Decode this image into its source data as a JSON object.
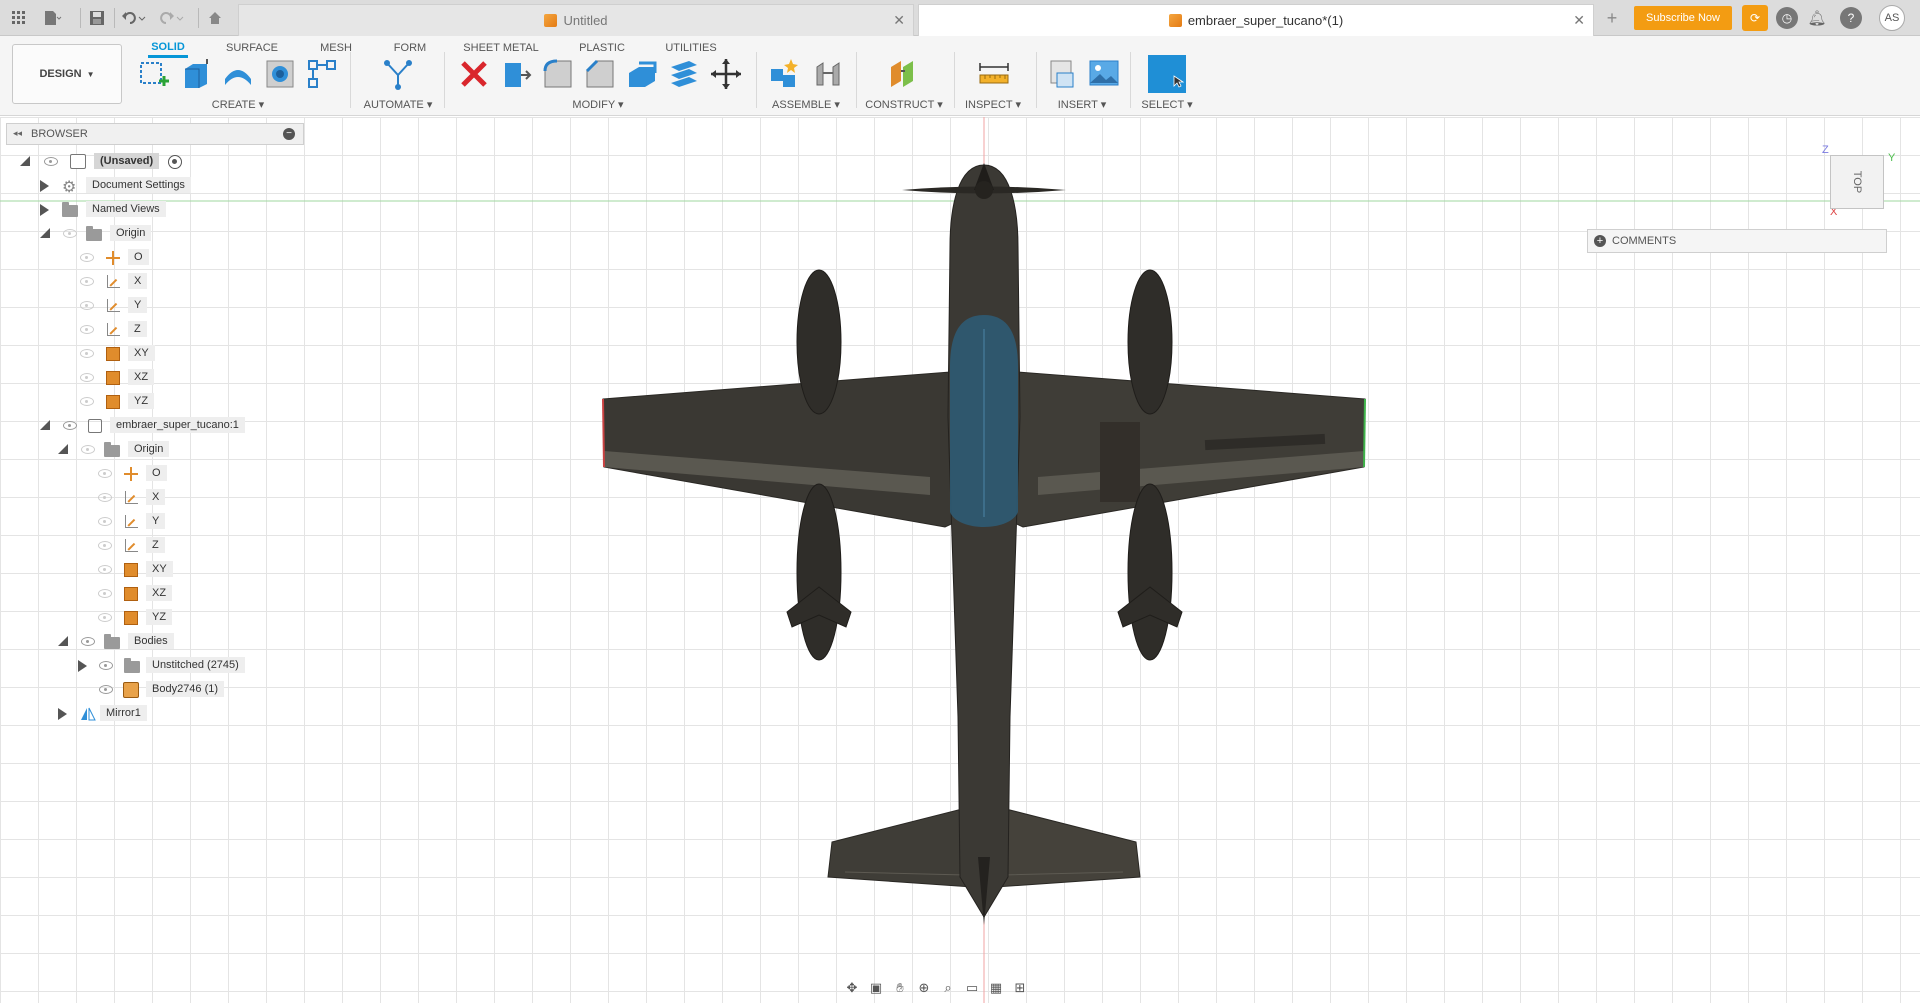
{
  "tabs": [
    {
      "label": "Untitled",
      "active": false
    },
    {
      "label": "embraer_super_tucano*(1)",
      "active": true
    }
  ],
  "header": {
    "subscribe_label": "Subscribe Now",
    "avatar_initials": "AS"
  },
  "toolbar": {
    "workspace_label": "DESIGN",
    "workspace_tabs": [
      "SOLID",
      "SURFACE",
      "MESH",
      "FORM",
      "SHEET METAL",
      "PLASTIC",
      "UTILITIES"
    ],
    "active_tab": "SOLID",
    "groups": [
      "CREATE",
      "AUTOMATE",
      "MODIFY",
      "ASSEMBLE",
      "CONSTRUCT",
      "INSPECT",
      "INSERT",
      "SELECT"
    ]
  },
  "browser": {
    "title": "BROWSER",
    "root_label": "(Unsaved)",
    "rows": [
      {
        "label": "Document Settings"
      },
      {
        "label": "Named Views"
      },
      {
        "label": "Origin"
      },
      {
        "label": "O"
      },
      {
        "label": "X"
      },
      {
        "label": "Y"
      },
      {
        "label": "Z"
      },
      {
        "label": "XY"
      },
      {
        "label": "XZ"
      },
      {
        "label": "YZ"
      },
      {
        "label": "embraer_super_tucano:1"
      },
      {
        "label": "Origin"
      },
      {
        "label": "O"
      },
      {
        "label": "X"
      },
      {
        "label": "Y"
      },
      {
        "label": "Z"
      },
      {
        "label": "XY"
      },
      {
        "label": "XZ"
      },
      {
        "label": "YZ"
      },
      {
        "label": "Bodies"
      },
      {
        "label": "Unstitched (2745)"
      },
      {
        "label": "Body2746 (1)"
      },
      {
        "label": "Mirror1"
      }
    ]
  },
  "viewcube": {
    "face": "TOP",
    "axis_z": "Z",
    "axis_y": "Y",
    "axis_x": "X"
  },
  "comments": {
    "label": "COMMENTS"
  },
  "colors": {
    "accent": "#0696d7",
    "subscribe": "#f39c12",
    "plane_body": "#3a3833"
  }
}
